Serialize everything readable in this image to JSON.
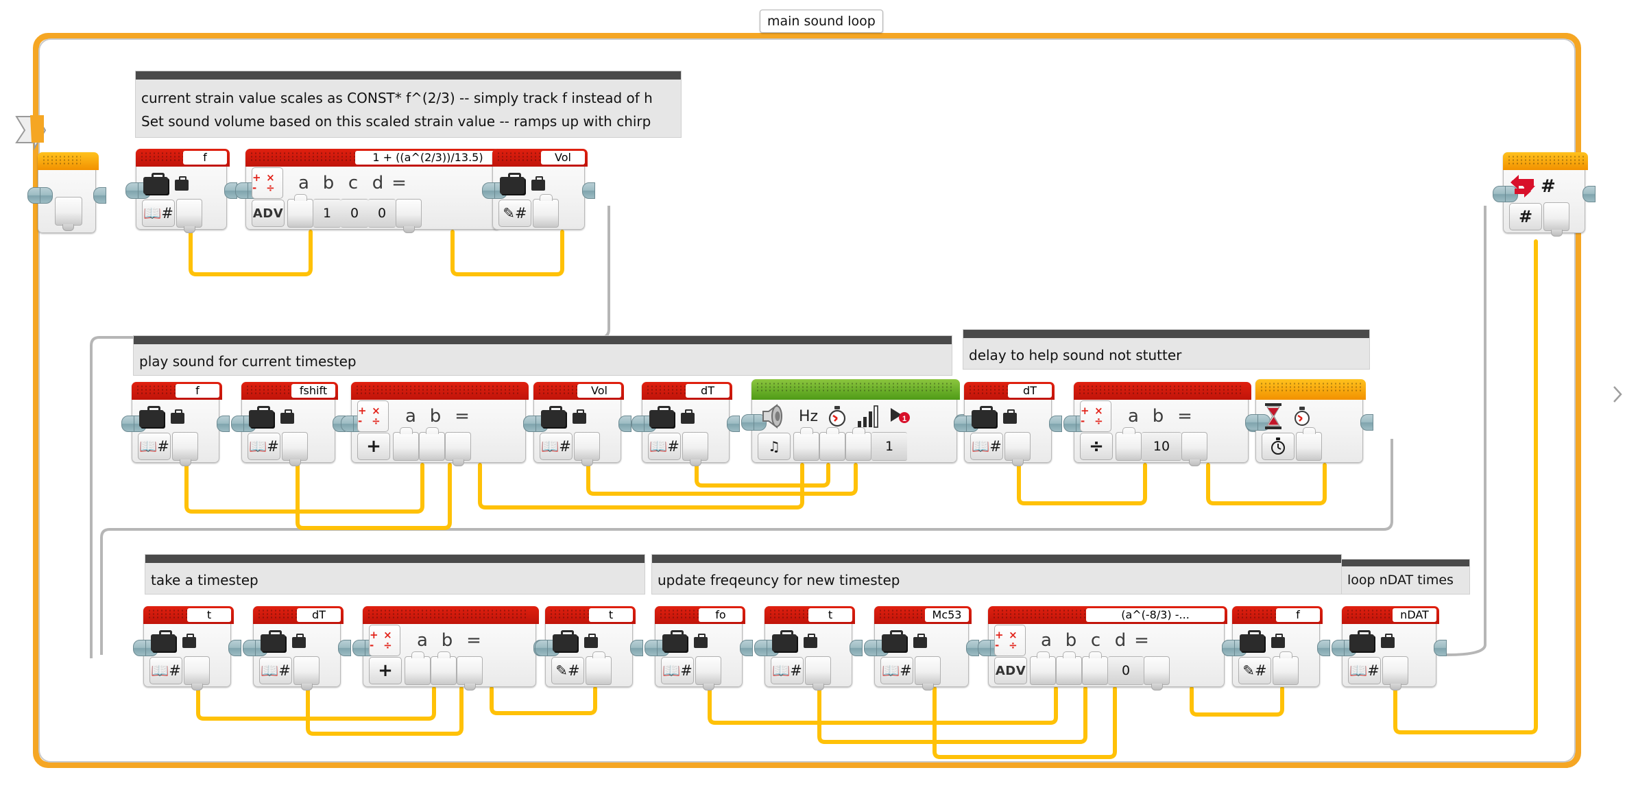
{
  "app": {
    "kind": "ev3-block-programming-canvas",
    "loop_label": "main sound loop"
  },
  "colors": {
    "loop_border": "#f5a623",
    "data_block_header": "#d4190c",
    "sound_block_header": "#6cb22c",
    "flow_block_header": "#f5a623",
    "wire": "#ffc107",
    "comment_bar": "#4a4a4a",
    "comment_body": "#e6e6e6"
  },
  "comments": [
    {
      "id": "comment-top",
      "lines": [
        "current strain value scales as CONST* f^(2/3) -- simply track f instead of h",
        "Set sound volume based on this scaled strain value -- ramps up with chirp"
      ]
    },
    {
      "id": "comment-play-sound",
      "lines": [
        "play sound for current timestep"
      ]
    },
    {
      "id": "comment-delay",
      "lines": [
        "delay to help sound not stutter"
      ]
    },
    {
      "id": "comment-timestep",
      "lines": [
        "take a timestep"
      ]
    },
    {
      "id": "comment-update-freq",
      "lines": [
        "update freqeuncy for new timestep"
      ]
    },
    {
      "id": "comment-loop-ndat",
      "lines": [
        "loop nDAT times"
      ]
    }
  ],
  "loop_start": {
    "name": "loop-start",
    "icon": "loop-start-icon",
    "header_color": "orange"
  },
  "loop_end": {
    "name": "loop-end",
    "icon": "loop-arrows-icon",
    "mode_icon": "hash-icon",
    "counter_label": "#",
    "header_color": "orange"
  },
  "rows": [
    {
      "id": "row-1",
      "blocks": [
        {
          "id": "r1-read-f",
          "type": "variable-read",
          "header_color": "red",
          "name": "f",
          "mode_icon": "book-hash-icon",
          "icons": [
            "suitcase-icon",
            "suitcase-small-icon"
          ],
          "slots": [
            {
              "value": "",
              "kind": "output"
            }
          ]
        },
        {
          "id": "r1-math-adv",
          "type": "math-advanced",
          "header_color": "red",
          "name": "1 + ((a^(2/3))/13.5)",
          "mode_icon": "ADV",
          "ops_icon": "plus-minus-times-divide-icon",
          "params": [
            "a",
            "b",
            "c",
            "d"
          ],
          "equals": "=",
          "slots": [
            {
              "value": "",
              "kind": "input"
            },
            {
              "value": "1",
              "kind": "value"
            },
            {
              "value": "0",
              "kind": "value"
            },
            {
              "value": "0",
              "kind": "value"
            },
            {
              "value": "",
              "kind": "output"
            }
          ]
        },
        {
          "id": "r1-write-vol",
          "type": "variable-write",
          "header_color": "red",
          "name": "Vol",
          "mode_icon": "pencil-hash-icon",
          "icons": [
            "suitcase-icon",
            "suitcase-small-icon"
          ],
          "slots": [
            {
              "value": "",
              "kind": "input"
            }
          ]
        }
      ]
    },
    {
      "id": "row-2",
      "blocks": [
        {
          "id": "r2-read-f",
          "type": "variable-read",
          "header_color": "red",
          "name": "f",
          "mode_icon": "book-hash-icon",
          "slots": [
            {
              "value": "",
              "kind": "output"
            }
          ]
        },
        {
          "id": "r2-read-fshift",
          "type": "variable-read",
          "header_color": "red",
          "name": "fshift",
          "mode_icon": "book-hash-icon",
          "slots": [
            {
              "value": "",
              "kind": "output"
            }
          ]
        },
        {
          "id": "r2-math-add",
          "type": "math-basic",
          "header_color": "red",
          "name": "",
          "mode_icon": "plus-icon",
          "ops_icon": "plus-minus-times-divide-icon",
          "params": [
            "a",
            "b"
          ],
          "equals": "=",
          "slots": [
            {
              "value": "",
              "kind": "input"
            },
            {
              "value": "",
              "kind": "input"
            },
            {
              "value": "",
              "kind": "output"
            }
          ]
        },
        {
          "id": "r2-read-vol",
          "type": "variable-read",
          "header_color": "red",
          "name": "Vol",
          "mode_icon": "book-hash-icon",
          "slots": [
            {
              "value": "",
              "kind": "output"
            }
          ]
        },
        {
          "id": "r2-read-dt",
          "type": "variable-read",
          "header_color": "red",
          "name": "dT",
          "mode_icon": "book-hash-icon",
          "slots": [
            {
              "value": "",
              "kind": "output"
            }
          ]
        },
        {
          "id": "r2-sound",
          "type": "sound-play-tone",
          "header_color": "green",
          "name": "",
          "mode_icon": "music-note-icon",
          "icons": [
            "speaker-icon",
            "hz-label",
            "stopwatch-icon",
            "volume-bars-icon",
            "play-once-icon"
          ],
          "hz_label": "Hz",
          "play_type_value": "1",
          "slots": [
            {
              "value": "",
              "kind": "input"
            },
            {
              "value": "",
              "kind": "input"
            },
            {
              "value": "",
              "kind": "input"
            },
            {
              "value": "1",
              "kind": "value"
            }
          ]
        },
        {
          "id": "r2-read-dt2",
          "type": "variable-read",
          "header_color": "red",
          "name": "dT",
          "mode_icon": "book-hash-icon",
          "slots": [
            {
              "value": "",
              "kind": "output"
            }
          ]
        },
        {
          "id": "r2-math-div",
          "type": "math-basic",
          "header_color": "red",
          "name": "",
          "mode_icon": "divide-icon",
          "ops_icon": "plus-minus-times-divide-icon",
          "params": [
            "a",
            "b"
          ],
          "equals": "=",
          "slots": [
            {
              "value": "",
              "kind": "input"
            },
            {
              "value": "10",
              "kind": "value"
            },
            {
              "value": "",
              "kind": "output"
            }
          ]
        },
        {
          "id": "r2-wait",
          "type": "wait-time",
          "header_color": "orange",
          "name": "",
          "mode_icon": "stopwatch-icon",
          "icons": [
            "hourglass-icon",
            "stopwatch-small-icon"
          ],
          "slots": [
            {
              "value": "",
              "kind": "input"
            }
          ]
        }
      ]
    },
    {
      "id": "row-3",
      "blocks": [
        {
          "id": "r3-read-t",
          "type": "variable-read",
          "header_color": "red",
          "name": "t",
          "mode_icon": "book-hash-icon",
          "slots": [
            {
              "value": "",
              "kind": "output"
            }
          ]
        },
        {
          "id": "r3-read-dt",
          "type": "variable-read",
          "header_color": "red",
          "name": "dT",
          "mode_icon": "book-hash-icon",
          "slots": [
            {
              "value": "",
              "kind": "output"
            }
          ]
        },
        {
          "id": "r3-math-add",
          "type": "math-basic",
          "header_color": "red",
          "name": "",
          "mode_icon": "plus-icon",
          "ops_icon": "plus-minus-times-divide-icon",
          "params": [
            "a",
            "b"
          ],
          "equals": "=",
          "slots": [
            {
              "value": "",
              "kind": "input"
            },
            {
              "value": "",
              "kind": "input"
            },
            {
              "value": "",
              "kind": "output"
            }
          ]
        },
        {
          "id": "r3-write-t",
          "type": "variable-write",
          "header_color": "red",
          "name": "t",
          "mode_icon": "pencil-hash-icon",
          "slots": [
            {
              "value": "",
              "kind": "input"
            }
          ]
        },
        {
          "id": "r3-read-fo",
          "type": "variable-read",
          "header_color": "red",
          "name": "fo",
          "mode_icon": "book-hash-icon",
          "slots": [
            {
              "value": "",
              "kind": "output"
            }
          ]
        },
        {
          "id": "r3-read-t2",
          "type": "variable-read",
          "header_color": "red",
          "name": "t",
          "mode_icon": "book-hash-icon",
          "slots": [
            {
              "value": "",
              "kind": "output"
            }
          ]
        },
        {
          "id": "r3-read-mc53",
          "type": "variable-read",
          "header_color": "red",
          "name": "Mc53",
          "mode_icon": "book-hash-icon",
          "slots": [
            {
              "value": "",
              "kind": "output"
            }
          ]
        },
        {
          "id": "r3-math-adv",
          "type": "math-advanced",
          "header_color": "red",
          "name": "(a^(-8/3) -...",
          "mode_icon": "ADV",
          "ops_icon": "plus-minus-times-divide-icon",
          "params": [
            "a",
            "b",
            "c",
            "d"
          ],
          "equals": "=",
          "slots": [
            {
              "value": "",
              "kind": "input"
            },
            {
              "value": "",
              "kind": "input"
            },
            {
              "value": "",
              "kind": "input"
            },
            {
              "value": "0",
              "kind": "value"
            },
            {
              "value": "",
              "kind": "output"
            }
          ]
        },
        {
          "id": "r3-write-f",
          "type": "variable-write",
          "header_color": "red",
          "name": "f",
          "mode_icon": "pencil-hash-icon",
          "slots": [
            {
              "value": "",
              "kind": "input"
            }
          ]
        },
        {
          "id": "r3-read-ndat",
          "type": "variable-read",
          "header_color": "red",
          "name": "nDAT",
          "mode_icon": "book-hash-icon",
          "slots": [
            {
              "value": "",
              "kind": "output"
            }
          ]
        }
      ]
    }
  ]
}
